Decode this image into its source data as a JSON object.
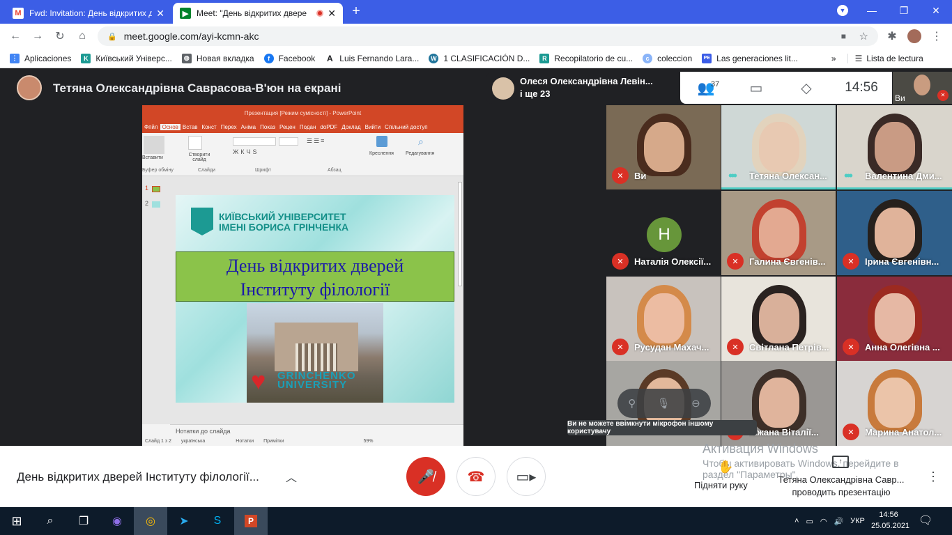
{
  "browser": {
    "tabs": [
      {
        "title": "Fwd: Invitation: День відкритих д",
        "icon": "gmail-icon"
      },
      {
        "title": "Meet: \"День відкритих двере",
        "icon": "meet-icon",
        "recording": true
      }
    ],
    "new_tab": "+",
    "address": "meet.google.com/ayi-kcmn-akc",
    "bookmarks": [
      {
        "label": "Aplicaciones",
        "color": "#4285f4",
        "glyph": "⋮⋮"
      },
      {
        "label": "Київський Універс...",
        "color": "#1c9a93",
        "glyph": "K"
      },
      {
        "label": "Новая вкладка",
        "color": "#5f6368",
        "glyph": "◍"
      },
      {
        "label": "Facebook",
        "color": "#1877f2",
        "glyph": "f"
      },
      {
        "label": "Luis Fernando Lara...",
        "color": "#202124",
        "glyph": "A"
      },
      {
        "label": "1 CLASIFICACIÓN D...",
        "color": "#21759b",
        "glyph": "W"
      },
      {
        "label": "Recopilatorio de cu...",
        "color": "#1c9a93",
        "glyph": "R"
      },
      {
        "label": "coleccion",
        "color": "#8ab4f8",
        "glyph": "c"
      },
      {
        "label": "Las generaciones lit...",
        "color": "#3b5ce6",
        "glyph": "PE"
      }
    ],
    "more_bookmarks": "»",
    "reading_list": "Lista de lectura"
  },
  "meet": {
    "presenter_banner": "Тетяна Олександрівна Саврасова-В'юн на екрані",
    "participant_header": {
      "name": "Олеся Олександрівна Левін...",
      "more": "і ще 23"
    },
    "people_count": "37",
    "clock": "14:56",
    "self_label": "Ви",
    "tiles": [
      {
        "name": "Ви",
        "muted": true,
        "bg": "#7a6a55",
        "face": "#d6a98a",
        "hair": "#4a2c1e"
      },
      {
        "name": "Тетяна Олексан...",
        "muted": false,
        "speaking": true,
        "bg": "#cfd8d6",
        "face": "#e8c9b2",
        "hair": "#e2d3bd"
      },
      {
        "name": "Валентина Дми...",
        "muted": false,
        "speaking": true,
        "bg": "#d9d5cc",
        "face": "#c99b84",
        "hair": "#3a2a26"
      },
      {
        "name": "Наталія Олексії...",
        "muted": true,
        "avatar_letter": "Н",
        "bg": "#202124"
      },
      {
        "name": "Галина Євгенів...",
        "muted": true,
        "bg": "#a89a86",
        "face": "#e3a991",
        "hair": "#c2412f"
      },
      {
        "name": "Ірина Євгенівн...",
        "muted": true,
        "bg": "#2f5f8a",
        "face": "#e0b39a",
        "hair": "#26201c"
      },
      {
        "name": "Русудан Махач...",
        "muted": true,
        "bg": "#c8c2bd",
        "face": "#ecbca2",
        "hair": "#d48a4a"
      },
      {
        "name": "Світлана Петрів...",
        "muted": true,
        "bg": "#e8e4dc",
        "face": "#d9b09a",
        "hair": "#2a2220"
      },
      {
        "name": "Анна Олегівна ...",
        "muted": true,
        "bg": "#8a2c3c",
        "face": "#e6b8a4",
        "hair": "#9c2a20"
      },
      {
        "name": "",
        "muted": false,
        "bg": "#a7a6a2",
        "face": "#e2b89b",
        "hair": "#5a3a26"
      },
      {
        "name": "ніжана Віталії...",
        "muted": true,
        "bg": "#9a9794",
        "face": "#e0b49c",
        "hair": "#3d2f28"
      },
      {
        "name": "Марина Анатол...",
        "muted": true,
        "bg": "#d7d4d2",
        "face": "#ebc4a9",
        "hair": "#c87a3c"
      }
    ],
    "tooltip": "Ви не можете ввімкнути мікрофон іншому користувачу",
    "meeting_title": "День відкритих дверей Інституту філології...",
    "raise_hand": "Підняти руку",
    "presenting": {
      "name": "Тетяна Олександрівна Савр...",
      "action": "проводить презентацію"
    },
    "watermark": {
      "title": "Активация Windows",
      "body": "Чтобы активировать Windows, перейдите в раздел \"Параметры\"."
    }
  },
  "ppt": {
    "title": "Презентация [Режим сумісності] - PowerPoint",
    "tabs": [
      "Фпйл",
      "Основ",
      "Встав",
      "Конст",
      "Перех",
      "Аніма",
      "Показ",
      "Рецен",
      "Подан",
      "doPDF",
      "Доклад",
      "Вийти",
      "Спільний доступ"
    ],
    "ribbon": {
      "paste": "Вставити",
      "clipboard": "Буфер обміну",
      "new_slide": "Створити слайд",
      "slides": "Слайди",
      "font": "Шрифт",
      "paragraph": "Абзац",
      "drawing": "Креслення",
      "editing": "Редагування"
    },
    "thumbs": [
      "1",
      "2"
    ],
    "slide": {
      "uni_line1": "КИЇВСЬКИЙ УНІВЕРСИТЕТ",
      "uni_line2": "ІМЕНІ БОРИСА ГРІНЧЕНКА",
      "title_line1": "День відкритих дверей",
      "title_line2": "Інституту філології",
      "grin1": "GRINCHENKO",
      "grin2": "UNIVERSITY"
    },
    "notes": "Нотатки до слайда",
    "status": [
      "Слайд 1 з 2",
      "українська",
      "Нотатки",
      "Примітки",
      "59%"
    ]
  },
  "taskbar": {
    "lang": "УКР",
    "time": "14:56",
    "date": "25.05.2021"
  }
}
